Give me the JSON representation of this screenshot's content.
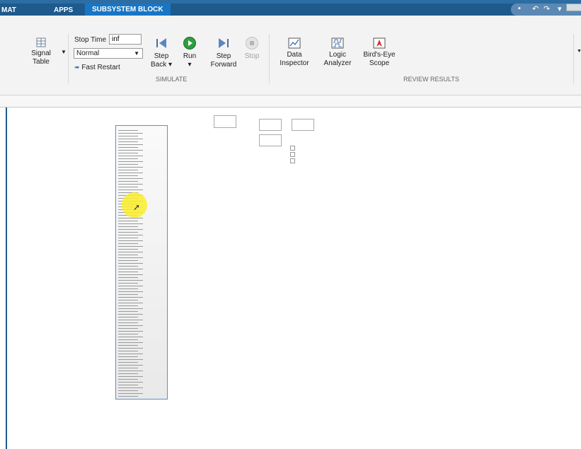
{
  "tabs": [
    "MAT",
    "APPS",
    "SUBSYSTEM BLOCK"
  ],
  "ribbon": {
    "signal_table": "Signal\nTable",
    "stop_time_label": "Stop Time",
    "stop_time_value": "inf",
    "sim_mode": "Normal",
    "fast_restart": "Fast Restart",
    "step_back": "Step\nBack ▾",
    "run": "Run\n▾",
    "step_forward": "Step\nForward",
    "stop": "Stop",
    "data_inspector": "Data\nInspector",
    "logic_analyzer": "Logic\nAnalyzer",
    "birds_eye_scope": "Bird's-Eye\nScope",
    "simulate_label": "SIMULATE",
    "review_label": "REVIEW RESULTS"
  },
  "colors": {
    "title_bar": "#1e5a8c",
    "active_tab": "#1876c4",
    "highlight": "#f5e829",
    "run_green": "#2e9e3e"
  },
  "icons": [
    "signal-table-icon",
    "step-back-icon",
    "run-icon",
    "step-forward-icon",
    "stop-icon",
    "data-inspector-icon",
    "logic-analyzer-icon",
    "birds-eye-scope-icon",
    "fast-restart-icon",
    "save-icon",
    "undo-icon",
    "redo-icon"
  ]
}
